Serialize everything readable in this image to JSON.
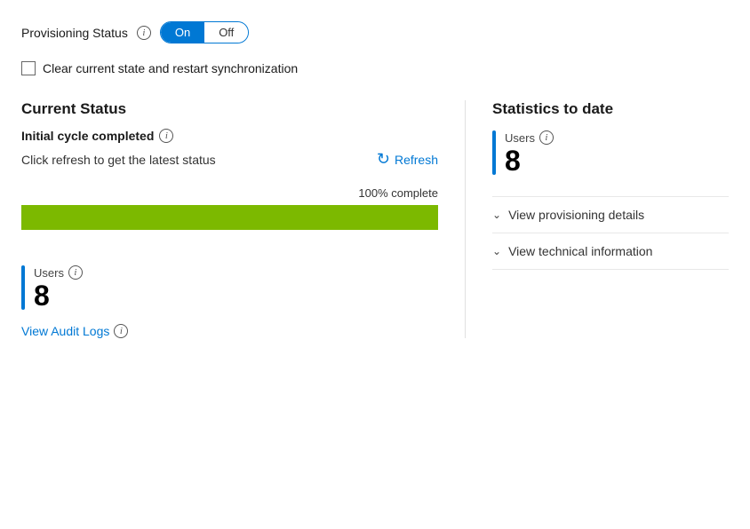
{
  "provisioning": {
    "label": "Provisioning Status",
    "info_icon": "i",
    "toggle_on": "On",
    "toggle_off": "Off"
  },
  "checkbox": {
    "label": "Clear current state and restart synchronization"
  },
  "left": {
    "section_title": "Current Status",
    "cycle_label": "Initial cycle completed",
    "refresh_hint": "Click refresh to get the latest status",
    "refresh_label": "Refresh",
    "progress_label": "100% complete",
    "progress_percent": 100,
    "users_label": "Users",
    "users_value": "8",
    "audit_link": "View Audit Logs"
  },
  "right": {
    "section_title": "Statistics to date",
    "users_label": "Users",
    "users_value": "8",
    "collapsibles": [
      {
        "label": "View provisioning details"
      },
      {
        "label": "View technical information"
      }
    ]
  }
}
